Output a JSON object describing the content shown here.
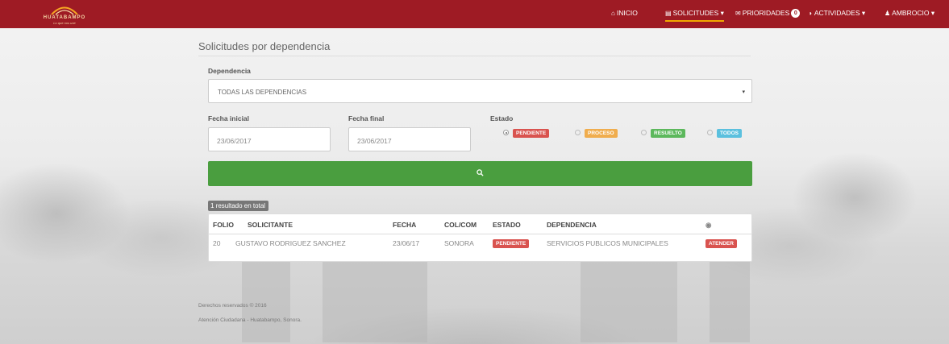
{
  "navbar": {
    "brand": "HUATABAMPO",
    "slogan": "Lo que nos une",
    "items": [
      {
        "icon": "home-icon",
        "label": "INICIO"
      },
      {
        "icon": "document-icon",
        "label": "SOLICITUDES",
        "active": true
      },
      {
        "icon": "envelope-icon",
        "label": "PRIORIDADES",
        "badge": "0"
      },
      {
        "icon": "ticket-icon",
        "label": "ACTIVIDADES"
      },
      {
        "icon": "user-icon",
        "label": "AMBROCIO"
      }
    ],
    "bg_color": "#9e1b24"
  },
  "page": {
    "title": "Solicitudes por dependencia"
  },
  "form": {
    "dependencia_label": "Dependencia",
    "dependencia_value": "TODAS LAS DEPENDENCIAS",
    "fecha_inicial_label": "Fecha inicial",
    "fecha_inicial_value": "23/06/2017",
    "fecha_final_label": "Fecha final",
    "fecha_final_value": "23/06/2017",
    "estado_label": "Estado",
    "estado_options": [
      {
        "label": "PENDIENTE",
        "selected": true,
        "color": "#d9534f"
      },
      {
        "label": "PROCESO",
        "selected": false,
        "color": "#f0ad4e"
      },
      {
        "label": "RESUELTO",
        "selected": false,
        "color": "#5cb85c"
      },
      {
        "label": "TODOS",
        "selected": false,
        "color": "#5bc0de"
      }
    ],
    "search_icon": "search-icon"
  },
  "results": {
    "count_text": "1 resultado en total",
    "columns": [
      "FOLIO",
      "SOLICITANTE",
      "FECHA",
      "COL/COM",
      "ESTADO",
      "DEPENDENCIA"
    ],
    "rows": [
      {
        "folio": "20",
        "solicitante": "GUSTAVO RODRIGUEZ SANCHEZ",
        "fecha": "23/06/17",
        "colcom": "SONORA",
        "estado": "PENDIENTE",
        "dependencia": "SERVICIOS PUBLICOS MUNICIPALES",
        "action": "ATENDER"
      }
    ]
  },
  "footer": {
    "copyright": "Derechos reservados © 2016",
    "subtitle": "Atención Ciudadana - Huatabampo, Sonora."
  }
}
